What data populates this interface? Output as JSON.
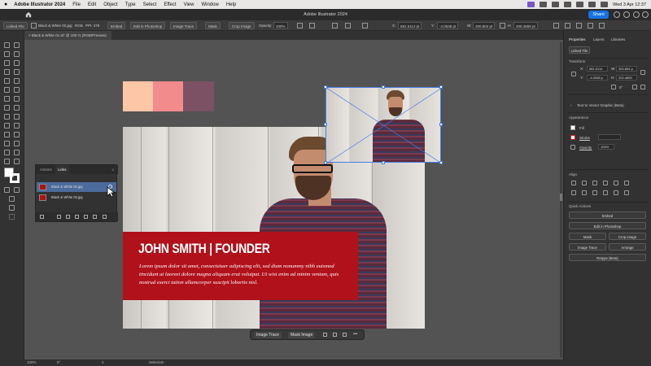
{
  "menubar": {
    "apple": "",
    "app_name": "Adobe Illustrator 2024",
    "items": [
      "File",
      "Edit",
      "Object",
      "Type",
      "Select",
      "Effect",
      "View",
      "Window",
      "Help"
    ],
    "clock": "Wed 3 Apr  12:37"
  },
  "appbar": {
    "title": "Adobe Illustrator 2024",
    "share_label": "Share"
  },
  "control_bar": {
    "linked_file": "Linked File",
    "file_name": "Black & White 02.jpg",
    "color_mode": "RGB",
    "ppi": "PPI: 479",
    "embed": "Embed",
    "edit_in_photoshop": "Edit in Photoshop",
    "image_trace": "Image Trace",
    "mask": "Mask",
    "crop_image": "Crop Image",
    "opacity_label": "Opacity:",
    "opacity_value": "100%",
    "x_label": "X:",
    "x_value": "681.5114 pt",
    "y_label": "Y:",
    "y_value": "-4.0538 pt",
    "w_label": "W:",
    "w_value": "300.804 pt",
    "h_label": "H:",
    "h_value": "200.4859 pt"
  },
  "document_tab": {
    "label": "Black & White 01.ai* @ 100 % (RGB/Preview)",
    "close": "×"
  },
  "swatches": [
    "#fcc6a7",
    "#f28b8c",
    "#7b5163"
  ],
  "banner": {
    "heading": "JOHN SMITH | FOUNDER",
    "body": "Lorem ipsum dolor sit amet, consectetuer adipiscing elit, sed diam nonummy nibh euismod tincidunt ut laoreet dolore magna aliquam erat volutpat. Ut wisi enim ad minim veniam, quis nostrud exerci tation ullamcorper suscipit lobortis nisl."
  },
  "links_panel": {
    "tabs": [
      "Actions",
      "Links"
    ],
    "menu": "≡",
    "rows": [
      "Black & White 02.jpg",
      "Black & White 02.jpg"
    ]
  },
  "context_bar": {
    "image_trace": "Image Trace",
    "mask_image": "Mask Image",
    "more": "•••"
  },
  "status_bar": {
    "zoom": "100%",
    "rotation": "0°",
    "page": "1",
    "tool": "Selection"
  },
  "properties_panel": {
    "tabs": [
      "Properties",
      "Layers",
      "Libraries"
    ],
    "linked_file": "Linked File",
    "transform": "Transform",
    "x_label": "X:",
    "x_value": "681.5114",
    "y_label": "Y:",
    "y_value": "-4.0538 p",
    "w_label": "W:",
    "w_value": "300.804 p",
    "h_label": "H:",
    "h_value": "200.4859",
    "rotation": "0°",
    "text_to_vector": "Text to Vector Graphic (Beta)",
    "appearance": "Appearance",
    "fill": "Fill",
    "stroke": "Stroke",
    "opacity": "Opacity",
    "opacity_value": "100%",
    "align": "Align",
    "quick_actions": "Quick Actions",
    "qa_embed": "Embed",
    "qa_edit_photoshop": "Edit in Photoshop",
    "qa_mask": "Mask",
    "qa_crop": "Crop Image",
    "qa_image_trace": "Image Trace",
    "qa_arrange": "Arrange",
    "qa_retype": "Retype (Beta)"
  },
  "colors": {
    "banner_red": "#b0111a",
    "selection_blue": "#4a7ee0",
    "share_blue": "#1473e6"
  }
}
